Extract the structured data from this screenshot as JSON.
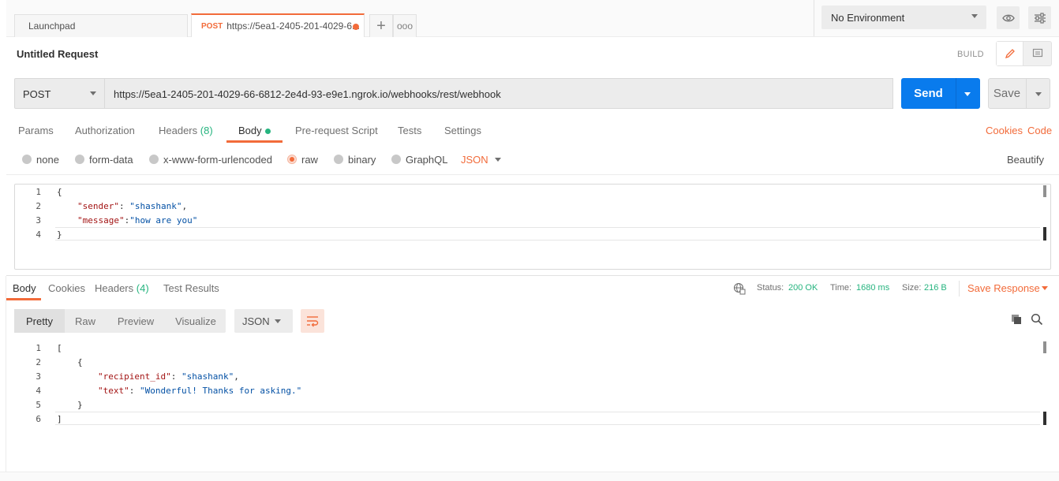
{
  "tabs": {
    "launchpad_label": "Launchpad",
    "active_method": "POST",
    "active_title": "https://5ea1-2405-201-4029-6...",
    "add_label": "+",
    "more_label": "ooo"
  },
  "environment": {
    "selected": "No Environment"
  },
  "request": {
    "title": "Untitled Request",
    "mode_label": "BUILD",
    "method": "POST",
    "url": "https://5ea1-2405-201-4029-66-6812-2e4d-93-e9e1.ngrok.io/webhooks/rest/webhook",
    "send_label": "Send",
    "save_label": "Save",
    "tabs": {
      "params": "Params",
      "authorization": "Authorization",
      "headers": "Headers",
      "headers_count": "(8)",
      "body": "Body",
      "pre_request": "Pre-request Script",
      "tests": "Tests",
      "settings": "Settings"
    },
    "cookies_link": "Cookies",
    "code_link": "Code",
    "body_modes": {
      "none": "none",
      "form_data": "form-data",
      "urlencoded": "x-www-form-urlencoded",
      "raw": "raw",
      "binary": "binary",
      "graphql": "GraphQL",
      "language": "JSON",
      "selected": "raw"
    },
    "beautify_label": "Beautify",
    "editor": {
      "line_numbers": [
        "1",
        "2",
        "3",
        "4"
      ],
      "line1": "{",
      "line2_key": "\"sender\"",
      "line2_rest": ": ",
      "line2_val": "\"shashank\"",
      "line2_end": ",",
      "line3_key": "\"message\"",
      "line3_rest": ":",
      "line3_val": "\"how are you\"",
      "line4": "}"
    }
  },
  "response": {
    "tabs": {
      "body": "Body",
      "cookies": "Cookies",
      "headers": "Headers",
      "headers_count": "(4)",
      "test_results": "Test Results"
    },
    "status_label": "Status:",
    "status_value": "200 OK",
    "time_label": "Time:",
    "time_value": "1680 ms",
    "size_label": "Size:",
    "size_value": "216 B",
    "save_response_label": "Save Response",
    "views": {
      "pretty": "Pretty",
      "raw": "Raw",
      "preview": "Preview",
      "visualize": "Visualize"
    },
    "language": "JSON",
    "editor": {
      "line_numbers": [
        "1",
        "2",
        "3",
        "4",
        "5",
        "6"
      ],
      "line1": "[",
      "line2": "{",
      "line3_key": "\"recipient_id\"",
      "line3_rest": ": ",
      "line3_val": "\"shashank\"",
      "line3_end": ",",
      "line4_key": "\"text\"",
      "line4_rest": ": ",
      "line4_val": "\"Wonderful! Thanks for asking.\"",
      "line5": "}",
      "line6": "]"
    }
  },
  "colors": {
    "accent": "#f26b3a",
    "send": "#097bed",
    "success": "#26b47f"
  },
  "icons": [
    "plus-icon",
    "more-icon",
    "eye-icon",
    "sliders-icon",
    "pencil-icon",
    "comment-icon",
    "caret-down-icon",
    "globe-icon",
    "copy-icon",
    "search-icon",
    "wrap-icon"
  ]
}
